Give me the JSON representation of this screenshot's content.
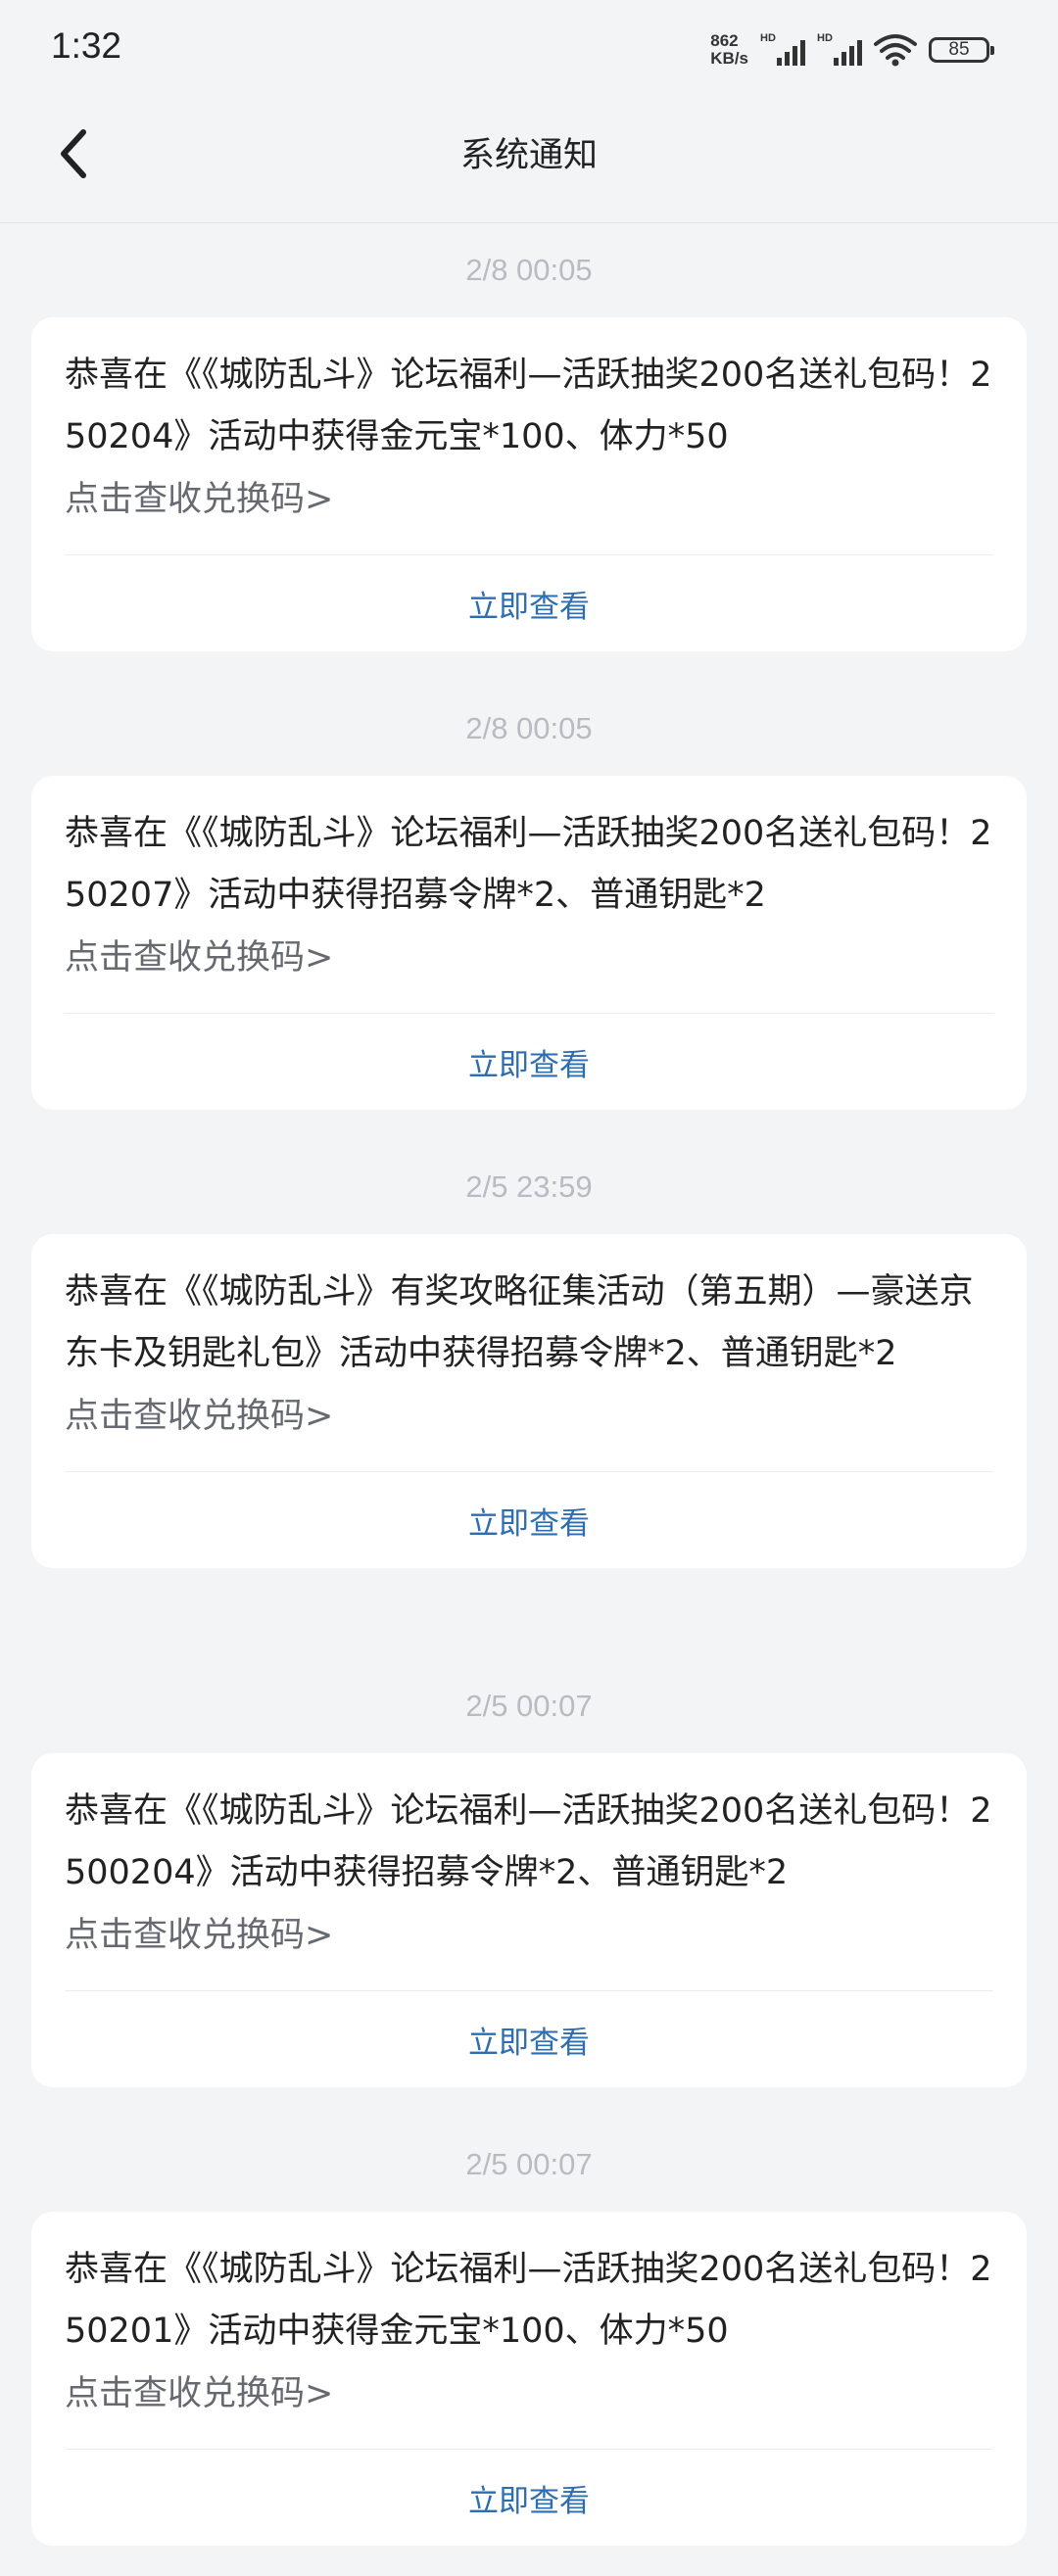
{
  "status_bar": {
    "time": "1:32",
    "net_speed_value": "862",
    "net_speed_unit": "KB/s",
    "signal_1_label": "HD",
    "signal_2_label": "HD",
    "battery": "85"
  },
  "header": {
    "title": "系统通知"
  },
  "messages": [
    {
      "time": "2/8  00:05",
      "text": "恭喜在《《城防乱斗》论坛福利—活跃抽奖200名送礼包码！250204》活动中获得金元宝*100、体力*50",
      "link": "点击查收兑换码>",
      "action": "立即查看"
    },
    {
      "time": "2/8  00:05",
      "text": "恭喜在《《城防乱斗》论坛福利—活跃抽奖200名送礼包码！250207》活动中获得招募令牌*2、普通钥匙*2",
      "link": "点击查收兑换码>",
      "action": "立即查看"
    },
    {
      "time": "2/5  23:59",
      "text": "恭喜在《《城防乱斗》有奖攻略征集活动（第五期）—豪送京东卡及钥匙礼包》活动中获得招募令牌*2、普通钥匙*2",
      "link": "点击查收兑换码>",
      "action": "立即查看"
    },
    {
      "time": "2/5  00:07",
      "text": "恭喜在《《城防乱斗》论坛福利—活跃抽奖200名送礼包码！2500204》活动中获得招募令牌*2、普通钥匙*2",
      "link": "点击查收兑换码>",
      "action": "立即查看"
    },
    {
      "time": "2/5  00:07",
      "text": "恭喜在《《城防乱斗》论坛福利—活跃抽奖200名送礼包码！250201》活动中获得金元宝*100、体力*50",
      "link": "点击查收兑换码>",
      "action": "立即查看"
    }
  ]
}
